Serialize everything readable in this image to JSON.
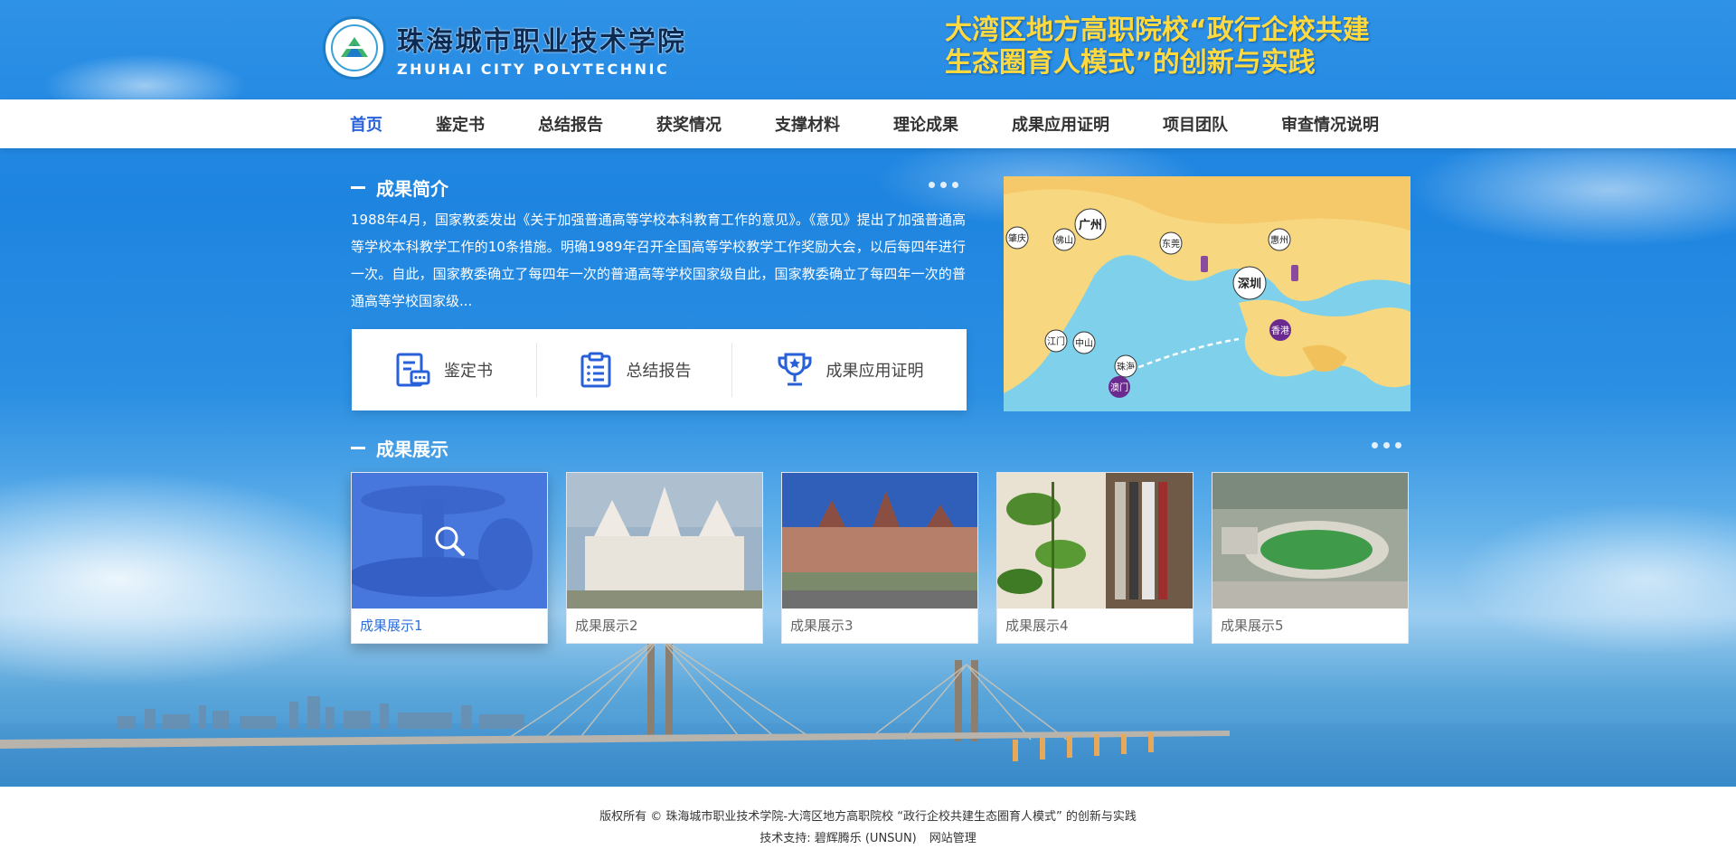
{
  "header": {
    "logo_cn": "珠海城市职业技术学院",
    "logo_en": "ZHUHAI CITY POLYTECHNIC",
    "slogan_line1": "大湾区地方高职院校“政行企校共建",
    "slogan_line2": "生态圈育人模式”的创新与实践"
  },
  "nav": {
    "items": [
      "首页",
      "鉴定书",
      "总结报告",
      "获奖情况",
      "支撑材料",
      "理论成果",
      "成果应用证明",
      "项目团队",
      "审查情况说明"
    ],
    "active": "首页"
  },
  "intro": {
    "title": "成果简介",
    "text": "1988年4月，国家教委发出《关于加强普通高等学校本科教育工作的意见》。《意见》提出了加强普通高等学校本科教学工作的10条措施。明确1989年召开全国高等学校教学工作奖励大会，以后每四年进行一次。自此，国家教委确立了每四年一次的普通高等学校国家级自此，国家教委确立了每四年一次的普通高等学校国家级..."
  },
  "quick_links": [
    {
      "label": "鉴定书",
      "icon": "certificate-icon"
    },
    {
      "label": "总结报告",
      "icon": "clipboard-list-icon"
    },
    {
      "label": "成果应用证明",
      "icon": "trophy-icon"
    }
  ],
  "map": {
    "labels": [
      "广州",
      "肇庆",
      "佛山",
      "东莞",
      "惠州",
      "深圳",
      "香港",
      "江门",
      "中山",
      "珠海",
      "澳门"
    ]
  },
  "gallery": {
    "title": "成果展示",
    "items": [
      {
        "caption": "成果展示1",
        "scene": "fountain-sculpture"
      },
      {
        "caption": "成果展示2",
        "scene": "white-temple"
      },
      {
        "caption": "成果展示3",
        "scene": "historic-building"
      },
      {
        "caption": "成果展示4",
        "scene": "plant-bookshelf"
      },
      {
        "caption": "成果展示5",
        "scene": "stadium"
      }
    ]
  },
  "footer": {
    "copyright": "版权所有 © 珠海城市职业技术学院-大湾区地方高职院校 “政行企校共建生态圈育人模式” 的创新与实践",
    "support": "技术支持: 碧辉腾乐 (UNSUN)",
    "admin_link": "网站管理"
  },
  "colors": {
    "accent": "#2760d8",
    "slogan": "#ffd940",
    "sky": "#1d84e0"
  }
}
